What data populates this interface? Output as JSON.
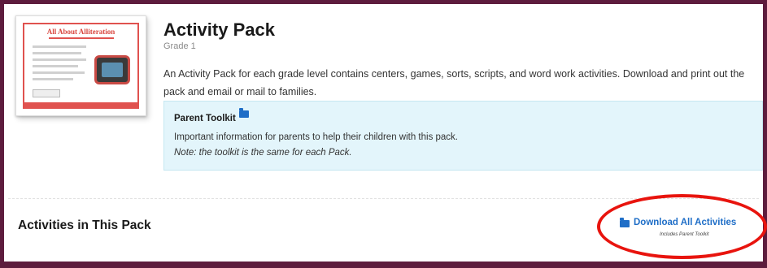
{
  "pack": {
    "title": "Activity Pack",
    "grade": "Grade 1",
    "description": "An Activity Pack for each grade level contains centers, games, sorts, scripts, and word work activities. Download and print out the pack and email or mail to families."
  },
  "thumbnail": {
    "title": "All About Alliteration"
  },
  "parent_toolkit": {
    "heading": "Parent Toolkit",
    "text": "Important information for parents to help their children with this pack.",
    "note": "Note: the toolkit is the same for each Pack."
  },
  "activities": {
    "section_title": "Activities in This Pack",
    "download_label": "Download All Activities",
    "download_sub": "Includes Parent Toolkit"
  },
  "colors": {
    "frame": "#5d1c3d",
    "link": "#1f6ec7",
    "toolkit_bg": "#e3f5fb",
    "highlight": "#e8140e"
  }
}
